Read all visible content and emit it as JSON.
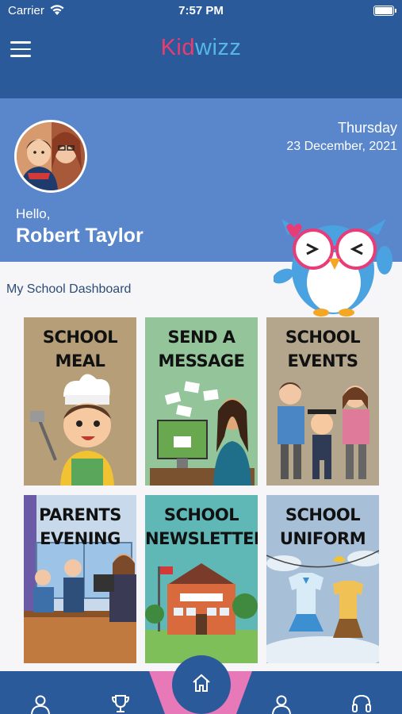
{
  "status_bar": {
    "carrier": "Carrier",
    "time": "7:57 PM"
  },
  "header": {
    "logo_part1": "Kid",
    "logo_part2": "wizz",
    "brand_pink": "#ec3b6f",
    "brand_blue": "#55b7e6"
  },
  "profile": {
    "day": "Thursday",
    "date": "23 December, 2021",
    "greeting": "Hello,",
    "name": "Robert Taylor"
  },
  "dashboard": {
    "title": "My School Dashboard",
    "tiles": [
      {
        "line1": "SCHOOL",
        "line2": "MEAL"
      },
      {
        "line1": "SEND A",
        "line2": "MESSAGE"
      },
      {
        "line1": "SCHOOL",
        "line2": "EVENTS"
      },
      {
        "line1": "PARENTS",
        "line2": "EVENING"
      },
      {
        "line1": "SCHOOL",
        "line2": "NEWSLETTER"
      },
      {
        "line1": "SCHOOL",
        "line2": "UNIFORM"
      }
    ]
  },
  "bottom_nav": {
    "icons": [
      "person-icon",
      "trophy-icon",
      "home-icon",
      "person-icon",
      "headset-icon"
    ]
  },
  "colors": {
    "header_bg": "#2a5a9a",
    "profile_bg": "#5a86cb"
  }
}
